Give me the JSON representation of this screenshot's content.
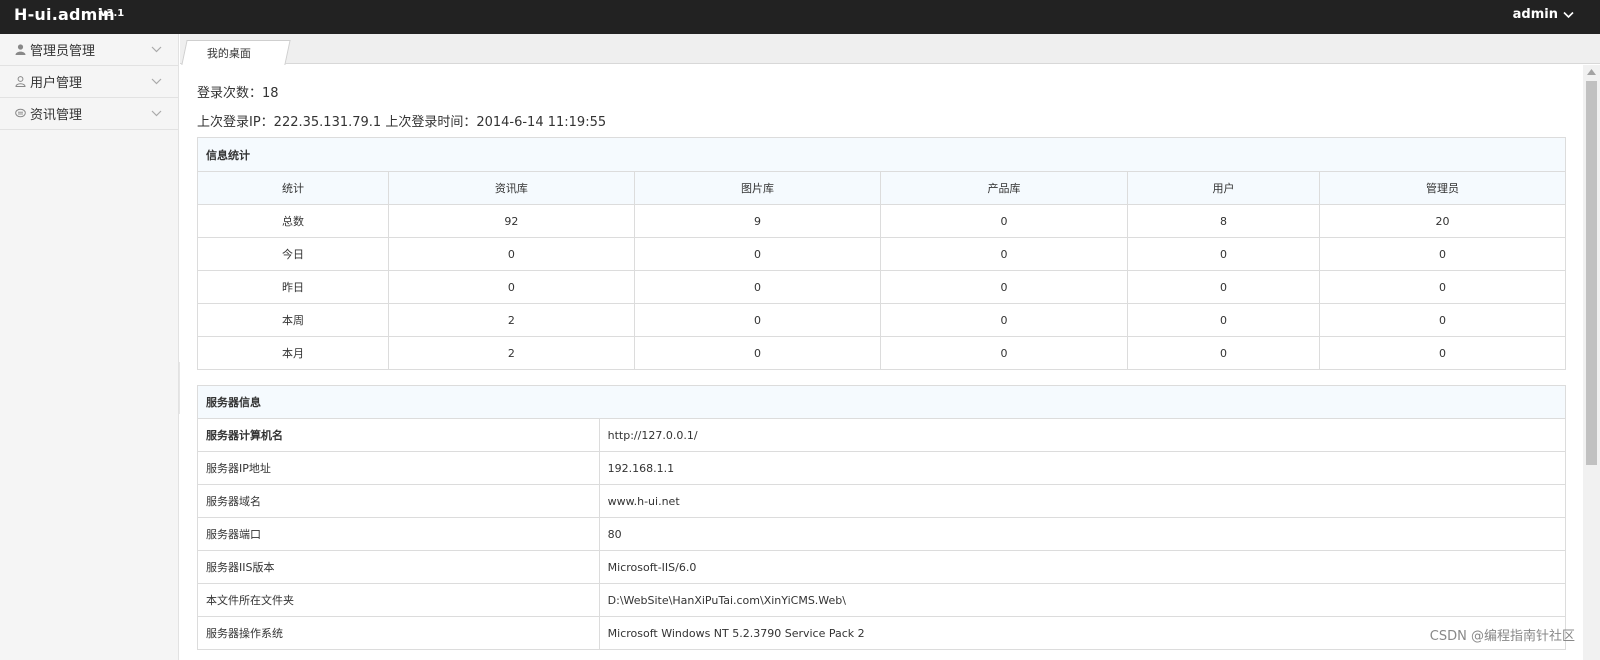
{
  "header": {
    "logo": "H-ui.admin",
    "version": "v3.1",
    "user": "admin"
  },
  "sidebar": {
    "items": [
      {
        "label": "管理员管理",
        "icon": "user-icon"
      },
      {
        "label": "用户管理",
        "icon": "user-outline-icon"
      },
      {
        "label": "资讯管理",
        "icon": "comment-icon"
      }
    ]
  },
  "tabs": [
    {
      "label": "我的桌面"
    }
  ],
  "main": {
    "login_count": "登录次数：18",
    "last_login": "上次登录IP：222.35.131.79.1 上次登录时间：2014-6-14 11:19:55"
  },
  "stats": {
    "title": "信息统计",
    "headers": [
      "统计",
      "资讯库",
      "图片库",
      "产品库",
      "用户",
      "管理员"
    ],
    "rows": [
      [
        "总数",
        "92",
        "9",
        "0",
        "8",
        "20"
      ],
      [
        "今日",
        "0",
        "0",
        "0",
        "0",
        "0"
      ],
      [
        "昨日",
        "0",
        "0",
        "0",
        "0",
        "0"
      ],
      [
        "本周",
        "2",
        "0",
        "0",
        "0",
        "0"
      ],
      [
        "本月",
        "2",
        "0",
        "0",
        "0",
        "0"
      ]
    ]
  },
  "server": {
    "title": "服务器信息",
    "rows": [
      [
        "服务器计算机名",
        "http://127.0.0.1/"
      ],
      [
        "服务器IP地址",
        "192.168.1.1"
      ],
      [
        "服务器域名",
        "www.h-ui.net"
      ],
      [
        "服务器端口",
        "80"
      ],
      [
        "服务器IIS版本",
        "Microsoft-IIS/6.0"
      ],
      [
        "本文件所在文件夹",
        "D:\\WebSite\\HanXiPuTai.com\\XinYiCMS.Web\\"
      ],
      [
        "服务器操作系统",
        "Microsoft Windows NT 5.2.3790 Service Pack 2"
      ]
    ]
  },
  "watermark": "CSDN @编程指南针社区"
}
